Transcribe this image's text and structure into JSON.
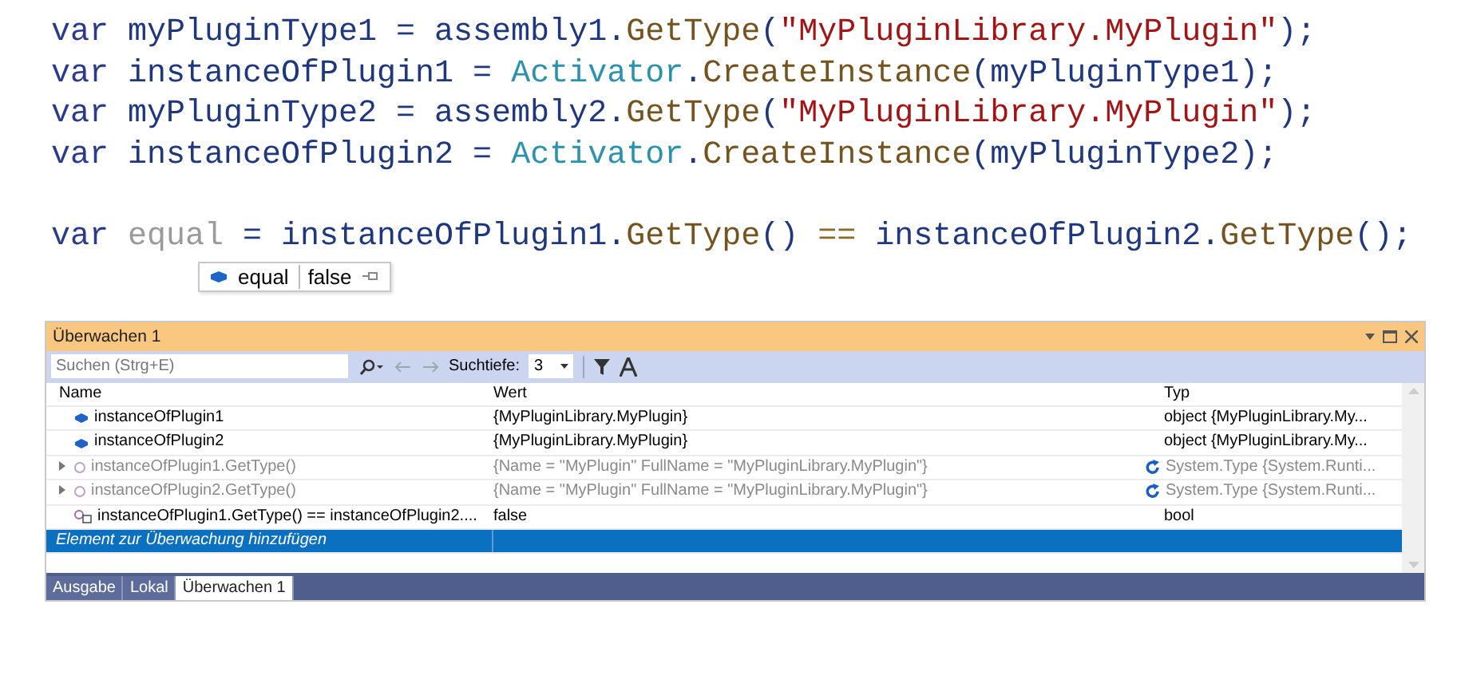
{
  "code": {
    "blocks": [
      [
        [
          {
            "text": "var",
            "kind": "keyword"
          },
          {
            "text": " myPluginType1 = assembly1.",
            "kind": "ident"
          },
          {
            "text": "GetType",
            "kind": "method"
          },
          {
            "text": "(",
            "kind": "ident"
          },
          {
            "text": "\"MyPluginLibrary.MyPlugin\"",
            "kind": "string"
          },
          {
            "text": ");",
            "kind": "ident"
          }
        ],
        [
          {
            "text": "var",
            "kind": "keyword"
          },
          {
            "text": " instanceOfPlugin1 = ",
            "kind": "ident"
          },
          {
            "text": "Activator",
            "kind": "type"
          },
          {
            "text": ".",
            "kind": "ident"
          },
          {
            "text": "CreateInstance",
            "kind": "method"
          },
          {
            "text": "(myPluginType1);",
            "kind": "ident"
          }
        ],
        [
          {
            "text": "var",
            "kind": "keyword"
          },
          {
            "text": " myPluginType2 = assembly2.",
            "kind": "ident"
          },
          {
            "text": "GetType",
            "kind": "method"
          },
          {
            "text": "(",
            "kind": "ident"
          },
          {
            "text": "\"MyPluginLibrary.MyPlugin\"",
            "kind": "string"
          },
          {
            "text": ");",
            "kind": "ident"
          }
        ],
        [
          {
            "text": "var",
            "kind": "keyword"
          },
          {
            "text": " instanceOfPlugin2 = ",
            "kind": "ident"
          },
          {
            "text": "Activator",
            "kind": "type"
          },
          {
            "text": ".",
            "kind": "ident"
          },
          {
            "text": "CreateInstance",
            "kind": "method"
          },
          {
            "text": "(myPluginType2);",
            "kind": "ident"
          }
        ]
      ],
      [
        [
          {
            "text": "var ",
            "kind": "keyword"
          },
          {
            "text": "equal",
            "kind": "unused"
          },
          {
            "text": " = instanceOfPlugin1.",
            "kind": "ident"
          },
          {
            "text": "GetType",
            "kind": "method"
          },
          {
            "text": "() ",
            "kind": "ident"
          },
          {
            "text": "==",
            "kind": "operator"
          },
          {
            "text": " instanceOfPlugin2.",
            "kind": "ident"
          },
          {
            "text": "GetType",
            "kind": "method"
          },
          {
            "text": "();",
            "kind": "ident"
          }
        ]
      ]
    ]
  },
  "datatip": {
    "name": "equal",
    "value": "false"
  },
  "watch": {
    "title": "Überwachen 1",
    "search": {
      "placeholder": "Suchen (Strg+E)"
    },
    "depth_label": "Suchtiefe:",
    "depth": "3",
    "columns": [
      "Name",
      "Wert",
      "Typ"
    ],
    "rows": [
      {
        "kind": "object",
        "name": "instanceOfPlugin1",
        "value": "{MyPluginLibrary.MyPlugin}",
        "type": "object {MyPluginLibrary.My...",
        "stale": false
      },
      {
        "kind": "object",
        "name": "instanceOfPlugin2",
        "value": "{MyPluginLibrary.MyPlugin}",
        "type": "object {MyPluginLibrary.My...",
        "stale": false
      },
      {
        "kind": "expandable",
        "name": "instanceOfPlugin1.GetType()",
        "value": "{Name = \"MyPlugin\" FullName = \"MyPluginLibrary.MyPlugin\"}",
        "type": "System.Type {System.Runti...",
        "stale": true
      },
      {
        "kind": "expandable",
        "name": "instanceOfPlugin2.GetType()",
        "value": "{Name = \"MyPlugin\" FullName = \"MyPluginLibrary.MyPlugin\"}",
        "type": "System.Type {System.Runti...",
        "stale": true
      },
      {
        "kind": "expression",
        "name": "instanceOfPlugin1.GetType() == instanceOfPlugin2....",
        "value": "false",
        "type": "bool",
        "stale": false
      }
    ],
    "add_row": {
      "placeholder": "Element zur Überwachung hinzufügen",
      "selected": true
    }
  },
  "tabs": [
    {
      "label": "Ausgabe",
      "selected": false
    },
    {
      "label": "Lokal",
      "selected": false
    },
    {
      "label": "Überwachen 1",
      "selected": true
    }
  ]
}
